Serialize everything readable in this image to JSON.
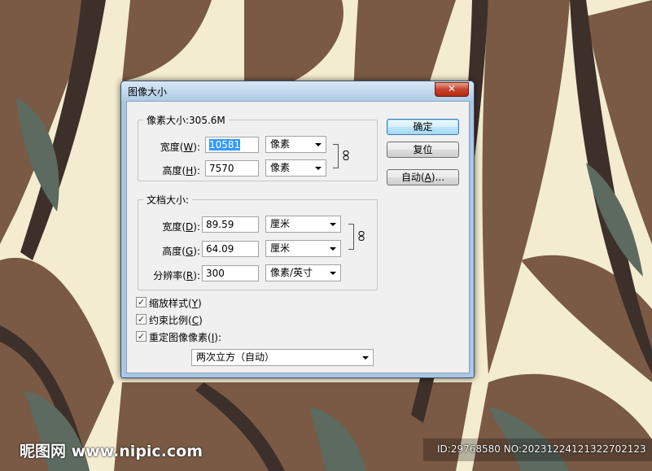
{
  "dialog": {
    "title": "图像大小",
    "close_glyph": "✕",
    "pixel_dimensions": {
      "legend": "像素大小:305.6M",
      "width": {
        "label": "宽度",
        "key": "W",
        "value": "10581",
        "unit": "像素"
      },
      "height": {
        "label": "高度",
        "key": "H",
        "value": "7570",
        "unit": "像素"
      }
    },
    "document_size": {
      "legend": "文档大小:",
      "width": {
        "label": "宽度",
        "key": "D",
        "value": "89.59",
        "unit": "厘米"
      },
      "height": {
        "label": "高度",
        "key": "G",
        "value": "64.09",
        "unit": "厘米"
      },
      "resolution": {
        "label": "分辨率",
        "key": "R",
        "value": "300",
        "unit": "像素/英寸"
      }
    },
    "buttons": {
      "ok": "确定",
      "reset": "复位",
      "auto_prefix": "自动(",
      "auto_key": "A",
      "auto_suffix": ")..."
    },
    "checkboxes": [
      {
        "label": "缩放样式",
        "key": "Y",
        "checked": true
      },
      {
        "label": "约束比例",
        "key": "C",
        "checked": true
      },
      {
        "label": "重定图像像素",
        "key": "I",
        "checked": true,
        "suffix": ":"
      }
    ],
    "resample_method": "两次立方（自动）"
  },
  "watermark": {
    "logo": "昵图网 www.nipic.com",
    "id_text": "ID:29768580 NO:20231224121322702123"
  }
}
